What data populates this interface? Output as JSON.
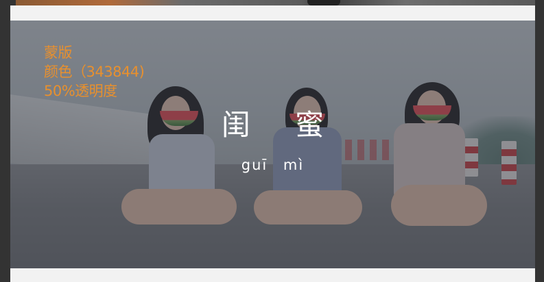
{
  "banner": {
    "note_lines": [
      "蒙版",
      "颜色（343844)",
      "50%透明度"
    ],
    "title": "闺 蜜",
    "pinyin": "guī  mì",
    "overlay_color": "#343844",
    "overlay_opacity": 0.5,
    "note_color": "#e8902e"
  }
}
